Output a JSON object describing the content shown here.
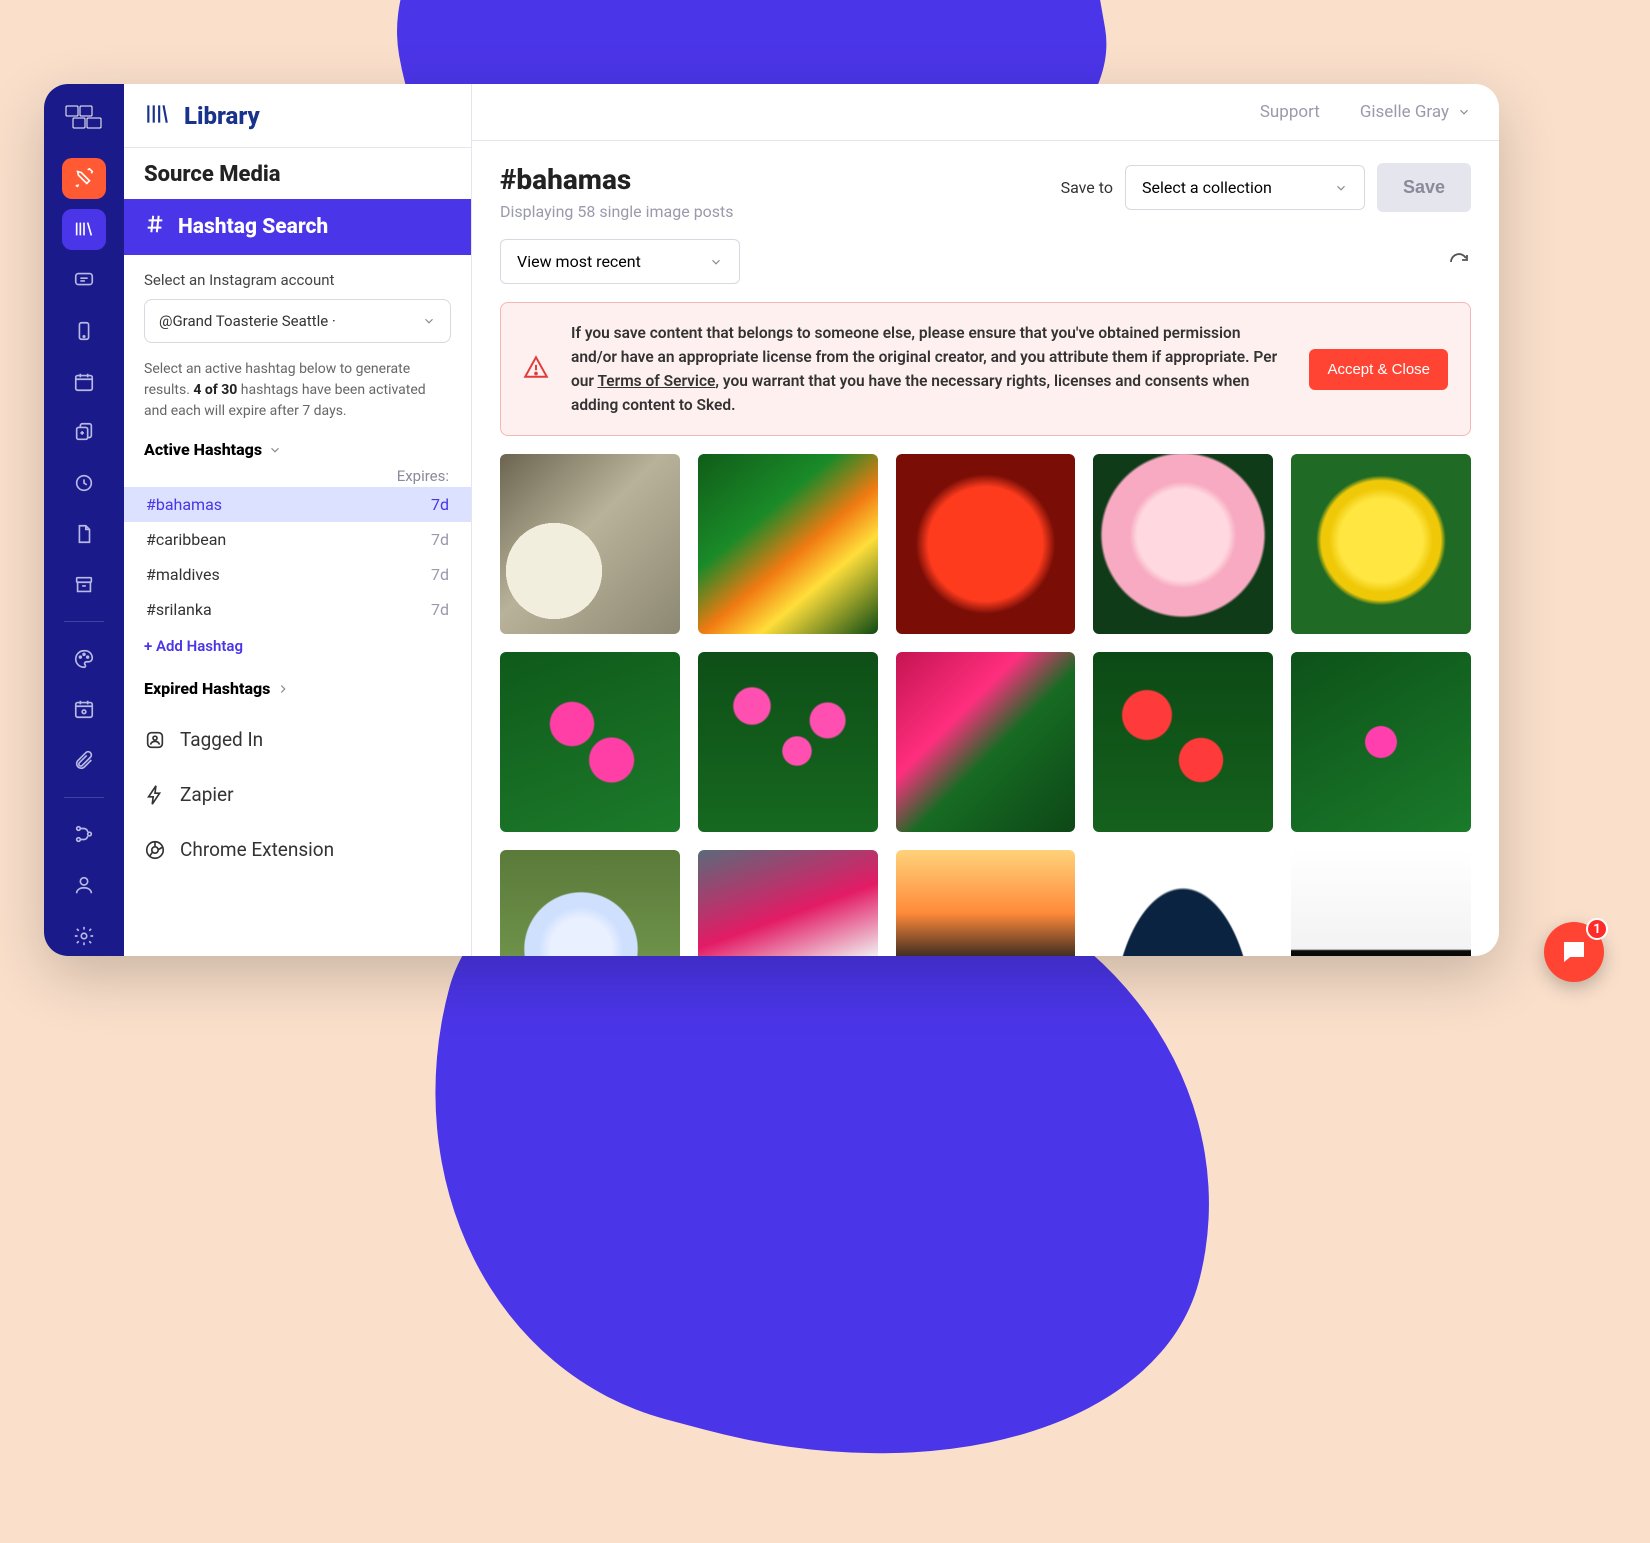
{
  "header": {
    "title": "Library",
    "support": "Support",
    "user": "Giselle Gray"
  },
  "panel": {
    "source_media": "Source Media",
    "hashtag_search": "Hashtag Search",
    "select_account_label": "Select an Instagram account",
    "account_value": "@Grand Toasterie Seattle ·",
    "help_text_1": "Select an active hashtag below to generate results. ",
    "help_text_bold": "4 of 30",
    "help_text_2": " hashtags have been activated and each will expire after 7 days.",
    "active_hashtags_label": "Active Hashtags",
    "expires_label": "Expires:",
    "hashtags": [
      {
        "name": "#bahamas",
        "expires": "7d",
        "selected": true
      },
      {
        "name": "#caribbean",
        "expires": "7d",
        "selected": false
      },
      {
        "name": "#maldives",
        "expires": "7d",
        "selected": false
      },
      {
        "name": "#srilanka",
        "expires": "7d",
        "selected": false
      }
    ],
    "add_hashtag": "+ Add Hashtag",
    "expired_hashtags_label": "Expired Hashtags",
    "sources": {
      "tagged_in": "Tagged In",
      "zapier": "Zapier",
      "chrome_ext": "Chrome Extension"
    }
  },
  "main": {
    "title": "#bahamas",
    "subtitle": "Displaying 58 single image posts",
    "save_to_label": "Save to",
    "collection_placeholder": "Select a collection",
    "save_button": "Save",
    "view_filter": "View most recent",
    "warning_text_1": "If you save content that belongs to someone else, please ensure that you've obtained permission and/or have an appropriate license from the original creator, and you attribute them if appropriate. Per our ",
    "warning_link": "Terms of Service",
    "warning_text_2": ", you warrant that you have the necessary rights, licenses and consents when adding content to Sked.",
    "accept_close": "Accept & Close"
  },
  "chat": {
    "badge": "1"
  },
  "thumbs": [
    "radial-gradient(circle at 30% 65%, #f2eedd 0 28%, transparent 28%), linear-gradient(135deg,#6b6550 0%,#b9b29a 45%,#8d8873 100%)",
    "linear-gradient(140deg,#105c18 0%,#1a8a28 35%,#f07a12 55%,#ffde3a 70%,#0d4a14 100%)",
    "radial-gradient(circle at 50% 50%, #ff3b1e 0 45%, #7a0e06 55% 100%)",
    "radial-gradient(circle at 50% 45%, #ffd9df 0 34%, #f7aac2 40% 60%, #0f3b18 62% 100%)",
    "radial-gradient(circle at 50% 48%, #ffe641 0 32%, #efc908 40% 46%, #1f6a24 50% 100%)",
    "radial-gradient(circle at 40% 40%,#ff3fa6 0 14%, transparent 15%), radial-gradient(circle at 62% 60%,#ff3fa6 0 14%, transparent 15%), linear-gradient(160deg,#0f5a1a 0%,#1c7a2a 100%)",
    "radial-gradient(circle at 30% 30%,#ff4fb0 0 10%,transparent 11%),radial-gradient(circle at 55% 55%,#ff4fb0 0 10%,transparent 11%),radial-gradient(circle at 72% 38%,#ff4fb0 0 10%,transparent 11%),linear-gradient(#0e4f17,#16681f)",
    "linear-gradient(135deg,#c51451 0%,#ff2e7e 35%,#176b23 55%,#0d4716 100%)",
    "radial-gradient(circle at 30% 35%,#ff3a3a 0 14%,transparent 15%),radial-gradient(circle at 60% 60%,#ff3a3a 0 14%,transparent 15%),linear-gradient(#0c4a15,#15611d)",
    "radial-gradient(circle at 50% 50%,#ff3fae 0 12%, transparent 13%), linear-gradient(150deg,#0d5219 0%,#1a7a2a 100%)",
    "radial-gradient(circle at 45% 55%,#e9f0ff 0 22%,#cfe0ff 30% 40%, transparent 41%), linear-gradient(#5a7a3a,#7ba254)",
    "linear-gradient(160deg,#5a6a7a 0%,#e31b65 40%,#f0f0f0 70%,#404850 100%)",
    "linear-gradient(180deg,#ffd27a 0%,#ff8a3a 35%,#3a2a20 60%,#1a120c 100%)",
    "radial-gradient(ellipse at 50% 100%, #0a2340 0 55%, #fff 56% 100%)",
    "linear-gradient(180deg,#ffffff 0%,#f3f3f3 55%,#0a0a0a 56%,#000 100%)"
  ]
}
